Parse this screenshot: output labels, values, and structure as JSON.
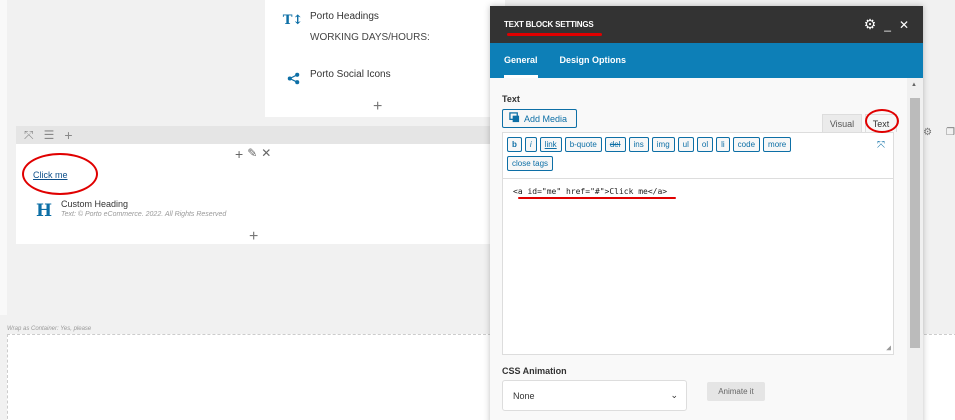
{
  "builder": {
    "porto_headings_label": "Porto Headings",
    "working_days_text": "WORKING DAYS/HOURS:",
    "porto_social_label": "Porto Social Icons",
    "click_me_link": "Click me",
    "custom_heading_title": "Custom Heading",
    "custom_heading_sub": "Text: © Porto eCommerce. 2022. All Rights Reserved",
    "wrap_note": "Wrap as Container: Yes, please"
  },
  "modal": {
    "title": "TEXT BLOCK SETTINGS",
    "tabs": [
      {
        "label": "General",
        "active": true
      },
      {
        "label": "Design Options",
        "active": false
      }
    ],
    "text_label": "Text",
    "add_media_label": "Add Media",
    "visual_tab": "Visual",
    "text_tab": "Text",
    "quicktags_row1": [
      "b",
      "i",
      "link",
      "b-quote",
      "del",
      "ins",
      "img",
      "ul",
      "ol",
      "li",
      "code",
      "more"
    ],
    "quicktags_row2": [
      "close tags"
    ],
    "editor_content": "<a id=\"me\" href=\"#\">Click me</a>",
    "css_animation_label": "CSS Animation",
    "css_animation_value": "None",
    "animate_button": "Animate it"
  },
  "colors": {
    "accent": "#0d7fb7",
    "header": "#333333",
    "annotation": "#e00000"
  }
}
